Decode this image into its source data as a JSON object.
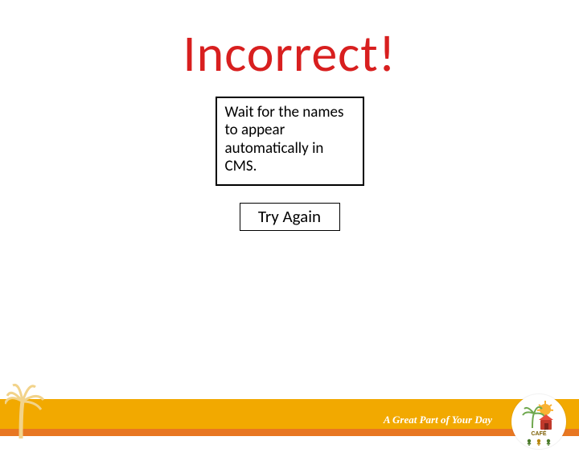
{
  "heading": "Incorrect!",
  "message": "Wait for the names to appear automatically in CMS.",
  "try_again_label": "Try Again",
  "footer": {
    "tagline": "A Great Part of Your Day",
    "logo_text_top": "CAFÉ",
    "colors": {
      "bar": "#f2a900",
      "strip": "#e87722",
      "heading": "#d81f1f"
    }
  }
}
